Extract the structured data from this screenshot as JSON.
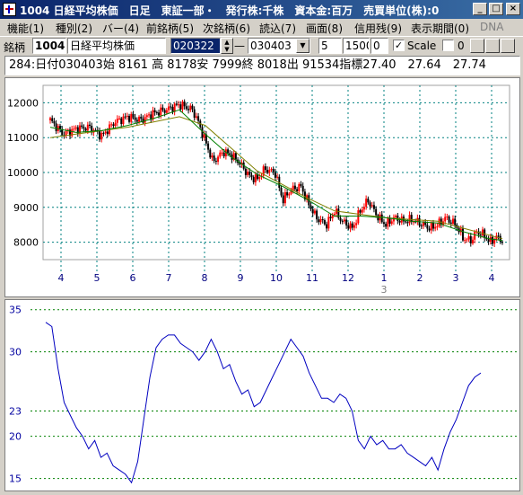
{
  "window": {
    "title": "1004 日経平均株価　日足　東証一部・　発行株:千株　資本金:百万　売買単位(株):0"
  },
  "menu": [
    "機能(1)",
    "種別(2)",
    "バー(4)",
    "前銘柄(5)",
    "次銘柄(6)",
    "読込(7)",
    "画面(8)",
    "信用残(9)",
    "表示期間(0)",
    "DNA"
  ],
  "toolbar": {
    "label": "銘柄",
    "code": "1004",
    "name": "日経平均株価",
    "start_date": "020322",
    "dash": "—",
    "end_date": "030403",
    "period": "5",
    "value1": "1500",
    "value2": "0",
    "scale_label": "Scale",
    "scale_value": "0",
    "scale_checked": "✓"
  },
  "info_line": "284:日付030403始 8161 高 8178安 7999終 8018出 91534指標27.40　27.64　27.74",
  "chart_data": [
    {
      "type": "candlestick",
      "y_ticks": [
        8000,
        9000,
        10000,
        11000,
        12000
      ],
      "ylim": [
        7500,
        12500
      ],
      "x_ticks": [
        "4",
        "5",
        "6",
        "7",
        "8",
        "9",
        "10",
        "11",
        "12",
        "1",
        "2",
        "3",
        "4"
      ],
      "year_marker": {
        "label": "3",
        "at": "1"
      },
      "colors": {
        "up": "#ff0000",
        "down": "#000000",
        "ma_short": "#008000",
        "ma_long": "#808000"
      },
      "close_path": [
        [
          0,
          11500
        ],
        [
          0.5,
          11100
        ],
        [
          1,
          11250
        ],
        [
          1.5,
          11300
        ],
        [
          2,
          11050
        ],
        [
          2.5,
          11450
        ],
        [
          3,
          11600
        ],
        [
          3.5,
          11500
        ],
        [
          4,
          11700
        ],
        [
          4.5,
          11800
        ],
        [
          5,
          11950
        ],
        [
          5.5,
          11800
        ],
        [
          5.7,
          11500
        ],
        [
          6,
          10900
        ],
        [
          6.3,
          10300
        ],
        [
          6.7,
          10600
        ],
        [
          7,
          10500
        ],
        [
          7.3,
          10300
        ],
        [
          7.7,
          9900
        ],
        [
          8,
          9800
        ],
        [
          8.3,
          10100
        ],
        [
          8.7,
          10000
        ],
        [
          9,
          9200
        ],
        [
          9.3,
          9500
        ],
        [
          9.7,
          9600
        ],
        [
          10,
          9100
        ],
        [
          10.3,
          8700
        ],
        [
          10.7,
          8500
        ],
        [
          11,
          8900
        ],
        [
          11.3,
          8600
        ],
        [
          11.7,
          8400
        ],
        [
          12,
          8900
        ],
        [
          12.3,
          9200
        ],
        [
          12.7,
          8700
        ],
        [
          13,
          8500
        ],
        [
          13.3,
          8700
        ],
        [
          13.7,
          8600
        ],
        [
          14,
          8650
        ],
        [
          14.3,
          8550
        ],
        [
          14.7,
          8400
        ],
        [
          15,
          8500
        ],
        [
          15.3,
          8700
        ],
        [
          15.7,
          8500
        ],
        [
          16,
          8100
        ],
        [
          16.3,
          8050
        ],
        [
          16.5,
          8300
        ],
        [
          16.8,
          8200
        ],
        [
          17,
          8000
        ],
        [
          17.3,
          8150
        ],
        [
          17.5,
          8050
        ]
      ],
      "ma_short_path": [
        [
          0,
          11300
        ],
        [
          1,
          11150
        ],
        [
          2,
          11200
        ],
        [
          3,
          11350
        ],
        [
          4,
          11550
        ],
        [
          5,
          11800
        ],
        [
          6,
          11100
        ],
        [
          7,
          10450
        ],
        [
          8,
          9950
        ],
        [
          9,
          9600
        ],
        [
          10,
          9200
        ],
        [
          11,
          8750
        ],
        [
          12,
          8750
        ],
        [
          13,
          8700
        ],
        [
          14,
          8600
        ],
        [
          15,
          8550
        ],
        [
          16,
          8300
        ],
        [
          17,
          8100
        ],
        [
          17.5,
          8050
        ]
      ],
      "ma_long_path": [
        [
          0,
          11000
        ],
        [
          1,
          11100
        ],
        [
          2,
          11200
        ],
        [
          3,
          11300
        ],
        [
          4,
          11450
        ],
        [
          5,
          11600
        ],
        [
          6,
          11350
        ],
        [
          7,
          10700
        ],
        [
          8,
          10050
        ],
        [
          9,
          9650
        ],
        [
          10,
          9250
        ],
        [
          11,
          8900
        ],
        [
          12,
          8800
        ],
        [
          13,
          8700
        ],
        [
          14,
          8650
        ],
        [
          15,
          8600
        ],
        [
          16,
          8400
        ],
        [
          17,
          8200
        ],
        [
          17.5,
          8100
        ]
      ]
    },
    {
      "type": "line",
      "y_ticks": [
        15,
        20,
        23,
        30,
        35
      ],
      "ylim": [
        14,
        35.5
      ],
      "color": "#0000c0",
      "values": [
        33.5,
        33,
        28,
        24,
        22.5,
        21,
        20,
        18.5,
        19.5,
        17.5,
        18,
        16.5,
        16,
        15.5,
        14.5,
        17,
        22,
        27,
        30.5,
        31.5,
        32,
        32,
        31,
        30.5,
        30,
        29,
        30,
        31.5,
        30,
        28,
        28.5,
        26.5,
        25,
        25.5,
        23.5,
        24,
        25.5,
        27,
        28.5,
        30,
        31.5,
        30.5,
        29.5,
        27.5,
        26,
        24.5,
        24.5,
        24,
        25,
        24.5,
        23,
        19.5,
        18.5,
        20,
        19,
        19.5,
        18.5,
        18.5,
        19,
        18,
        17.5,
        17,
        16.5,
        17.5,
        16,
        18.5,
        20.5,
        22,
        24,
        26,
        27,
        27.5
      ]
    }
  ]
}
